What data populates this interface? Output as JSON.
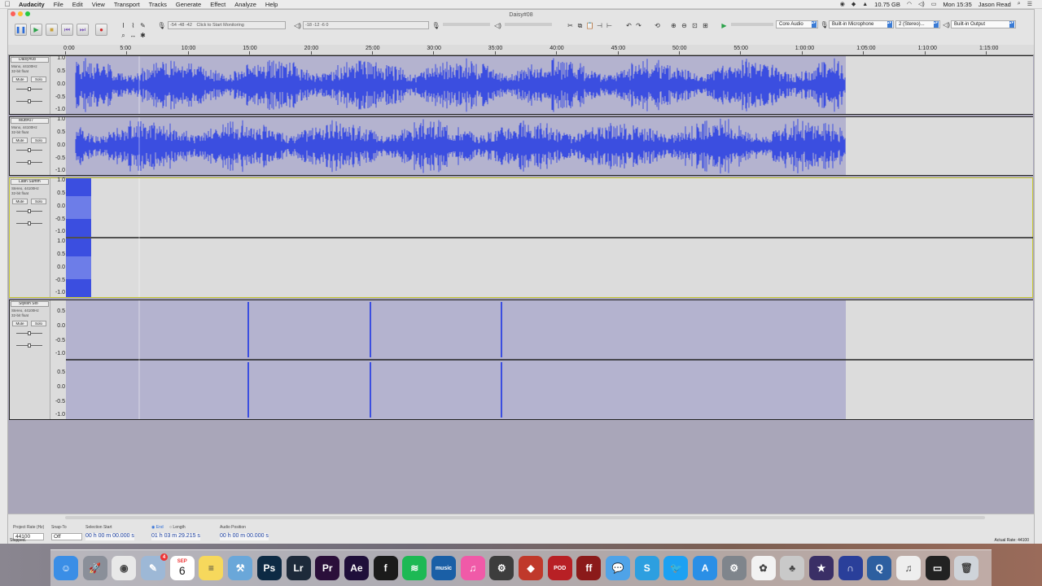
{
  "menubar": {
    "app_name": "Audacity",
    "menus": [
      "File",
      "Edit",
      "View",
      "Transport",
      "Tracks",
      "Generate",
      "Effect",
      "Analyze",
      "Help"
    ],
    "disk": "10.75 GB",
    "clock": "Mon 15:35",
    "user": "Jason Read"
  },
  "window": {
    "title": "Daisy#08"
  },
  "toolbar": {
    "meter_label": "Click to Start Monitoring",
    "meter_scale": "-54 -48 -42",
    "meter_scale2": "-18 -12 -6 0",
    "host": "Core Audio",
    "input_device": "Built-in Microphone",
    "channels": "2 (Stereo)...",
    "output_device": "Built-in Output"
  },
  "ruler": {
    "labels": [
      "0:00",
      "5:00",
      "10:00",
      "15:00",
      "20:00",
      "25:00",
      "30:00",
      "35:00",
      "40:00",
      "45:00",
      "50:00",
      "55:00",
      "1:00:00",
      "1:05:00",
      "1:10:00",
      "1:15:00"
    ]
  },
  "tracks": [
    {
      "name": "Daisy#08",
      "info1": "Mono, 44100Hz",
      "info2": "32-bit float",
      "mute": "Mute",
      "solo": "Solo",
      "scale": [
        "1.0",
        "0.5",
        "0.0",
        "-0.5",
        "-1.0"
      ]
    },
    {
      "name": "Mutt#07",
      "info1": "Mono, 44100Hz",
      "info2": "32-bit float",
      "mute": "Mute",
      "solo": "Solo",
      "scale": [
        "1.0",
        "0.5",
        "0.0",
        "-0.5",
        "-1.0"
      ]
    },
    {
      "name": "Latin Summ",
      "info1": "Stereo, 44100Hz",
      "info2": "32-bit float",
      "mute": "Mute",
      "solo": "Solo",
      "scale": [
        "1.0",
        "0.5",
        "0.0",
        "-0.5",
        "-1.0"
      ],
      "scale2": [
        "1.0",
        "0.5",
        "0.0",
        "-0.5",
        "-1.0"
      ]
    },
    {
      "name": "Stylish Sto",
      "info1": "Stereo, 44100Hz",
      "info2": "32-bit float",
      "mute": "Mute",
      "solo": "Solo",
      "scale": [
        "0.5",
        "0.0",
        "-0.5",
        "-1.0"
      ],
      "scale2": [
        "0.5",
        "0.0",
        "-0.5",
        "-1.0"
      ]
    }
  ],
  "selection_bar": {
    "project_rate_label": "Project Rate (Hz)",
    "project_rate": "44100",
    "snap_label": "Snap-To",
    "snap_value": "Off",
    "selection_start_label": "Selection Start",
    "end_label": "End",
    "length_label": "Length",
    "audio_position_label": "Audio Position",
    "selection_start": "00 h 00 m 00.000 s",
    "selection_end": "01 h 03 m 29.215 s",
    "audio_position": "00 h 00 m 00.000 s"
  },
  "status": {
    "state": "Stopped.",
    "actual_rate": "Actual Rate: 44100"
  },
  "dock": {
    "calendar_month": "SEP",
    "calendar_day": "6",
    "badge": "4",
    "apps": [
      {
        "name": "Finder",
        "color": "#3a8ee6",
        "glyph": "☺"
      },
      {
        "name": "Launchpad",
        "color": "#8a8f99",
        "glyph": "🚀"
      },
      {
        "name": "Chrome",
        "color": "#e8e8e8",
        "glyph": "◉"
      },
      {
        "name": "Preview",
        "color": "#9db8d6",
        "glyph": "✎"
      },
      {
        "name": "Calendar",
        "color": "#ffffff",
        "glyph": ""
      },
      {
        "name": "Notes",
        "color": "#f6d85c",
        "glyph": "≡"
      },
      {
        "name": "Xcode",
        "color": "#6aa7d9",
        "glyph": "⚒"
      },
      {
        "name": "Photoshop",
        "color": "#0d2a44",
        "glyph": "Ps"
      },
      {
        "name": "Lightroom",
        "color": "#1d2a3a",
        "glyph": "Lr"
      },
      {
        "name": "Premiere",
        "color": "#2b0f3a",
        "glyph": "Pr"
      },
      {
        "name": "After Effects",
        "color": "#1f0f3a",
        "glyph": "Ae"
      },
      {
        "name": "Font",
        "color": "#1b1b1b",
        "glyph": "f"
      },
      {
        "name": "Spotify",
        "color": "#1db954",
        "glyph": "≋"
      },
      {
        "name": "Amazon Music",
        "color": "#1a5fa6",
        "glyph": "music"
      },
      {
        "name": "iTunes",
        "color": "#f05aa8",
        "glyph": "♫"
      },
      {
        "name": "Utility",
        "color": "#3d3d3d",
        "glyph": "⚙"
      },
      {
        "name": "Reason",
        "color": "#c0392b",
        "glyph": "◆"
      },
      {
        "name": "Podcast",
        "color": "#b82025",
        "glyph": "POD"
      },
      {
        "name": "FontForge",
        "color": "#8b1a1a",
        "glyph": "ff"
      },
      {
        "name": "Messages",
        "color": "#4fa3e8",
        "glyph": "💬"
      },
      {
        "name": "Skype",
        "color": "#2d9fe0",
        "glyph": "S"
      },
      {
        "name": "Twitter",
        "color": "#1da1f2",
        "glyph": "🐦"
      },
      {
        "name": "App Store",
        "color": "#2a8fe6",
        "glyph": "A"
      },
      {
        "name": "System Preferences",
        "color": "#7f858c",
        "glyph": "⚙"
      },
      {
        "name": "Photos",
        "color": "#f2f2f2",
        "glyph": "✿"
      },
      {
        "name": "Instrument",
        "color": "#c9c9c9",
        "glyph": "♣"
      },
      {
        "name": "iMovie",
        "color": "#3a2f66",
        "glyph": "★"
      },
      {
        "name": "Audacity",
        "color": "#2a3f9a",
        "glyph": "∩"
      },
      {
        "name": "QuickTime",
        "color": "#2d5fa0",
        "glyph": "Q"
      },
      {
        "name": "Document",
        "color": "#eeeeee",
        "glyph": "♫"
      },
      {
        "name": "Screen",
        "color": "#222222",
        "glyph": "▭"
      },
      {
        "name": "Trash",
        "color": "#cfd4da",
        "glyph": "🗑"
      }
    ]
  }
}
